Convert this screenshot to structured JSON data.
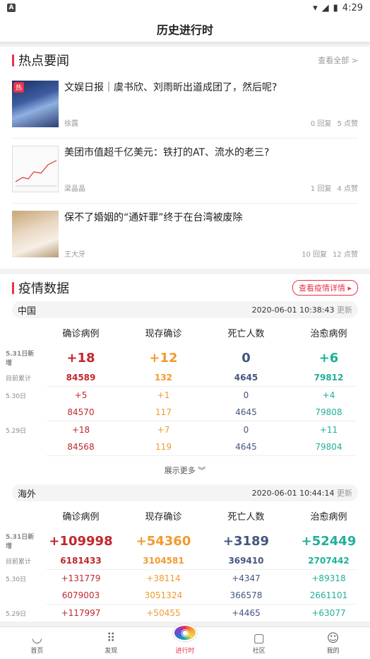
{
  "status": {
    "time": "4:29",
    "app_icon": "A"
  },
  "header": {
    "title": "历史进行时"
  },
  "news": {
    "title": "热点要闻",
    "view_all": "查看全部 >",
    "items": [
      {
        "hot_tag": "热",
        "title": "文娱日报｜虞书欣、刘雨昕出道成团了，然后呢?",
        "author": "徐露",
        "replies": "0 回复",
        "likes": "5 点赞"
      },
      {
        "title": "美团市值超千亿美元：铁打的AT、流水的老三?",
        "author": "梁晶晶",
        "replies": "1 回复",
        "likes": "4 点赞"
      },
      {
        "title": "保不了婚姻的“通奸罪”终于在台湾被废除",
        "author": "王大牙",
        "replies": "10 回复",
        "likes": "12 点赞"
      }
    ]
  },
  "epidemic": {
    "title": "疫情数据",
    "detail_btn": "查看疫情详情 ▸",
    "columns": [
      "确诊病例",
      "现存确诊",
      "死亡人数",
      "治愈病例"
    ],
    "china": {
      "name": "中国",
      "time": "2020-06-01 10:38:43",
      "update": "更新",
      "new_label": "5.31日新增",
      "new": [
        "+18",
        "+12",
        "0",
        "+6"
      ],
      "total_label": "目前累计",
      "total": [
        "84589",
        "132",
        "4645",
        "79812"
      ],
      "days": [
        {
          "label": "5.30日",
          "delta": [
            "+5",
            "+1",
            "0",
            "+4"
          ],
          "total": [
            "84570",
            "117",
            "4645",
            "79808"
          ]
        },
        {
          "label": "5.29日",
          "delta": [
            "+18",
            "+7",
            "0",
            "+11"
          ],
          "total": [
            "84568",
            "119",
            "4645",
            "79804"
          ]
        }
      ],
      "more": "展示更多 ︾"
    },
    "overseas": {
      "name": "海外",
      "time": "2020-06-01 10:44:14",
      "update": "更新",
      "new_label": "5.31日新增",
      "new": [
        "+109998",
        "+54360",
        "+3189",
        "+52449"
      ],
      "total_label": "目前累计",
      "total": [
        "6181433",
        "3104581",
        "369410",
        "2707442"
      ],
      "days": [
        {
          "label": "5.30日",
          "delta": [
            "+131779",
            "+38114",
            "+4347",
            "+89318"
          ],
          "total": [
            "6079003",
            "3051324",
            "366578",
            "2661101"
          ]
        },
        {
          "label": "5.29日",
          "delta": [
            "+117997",
            "+50455",
            "+4465",
            "+63077"
          ]
        }
      ]
    }
  },
  "tabs": [
    "首页",
    "发现",
    "进行时",
    "社区",
    "我的"
  ]
}
